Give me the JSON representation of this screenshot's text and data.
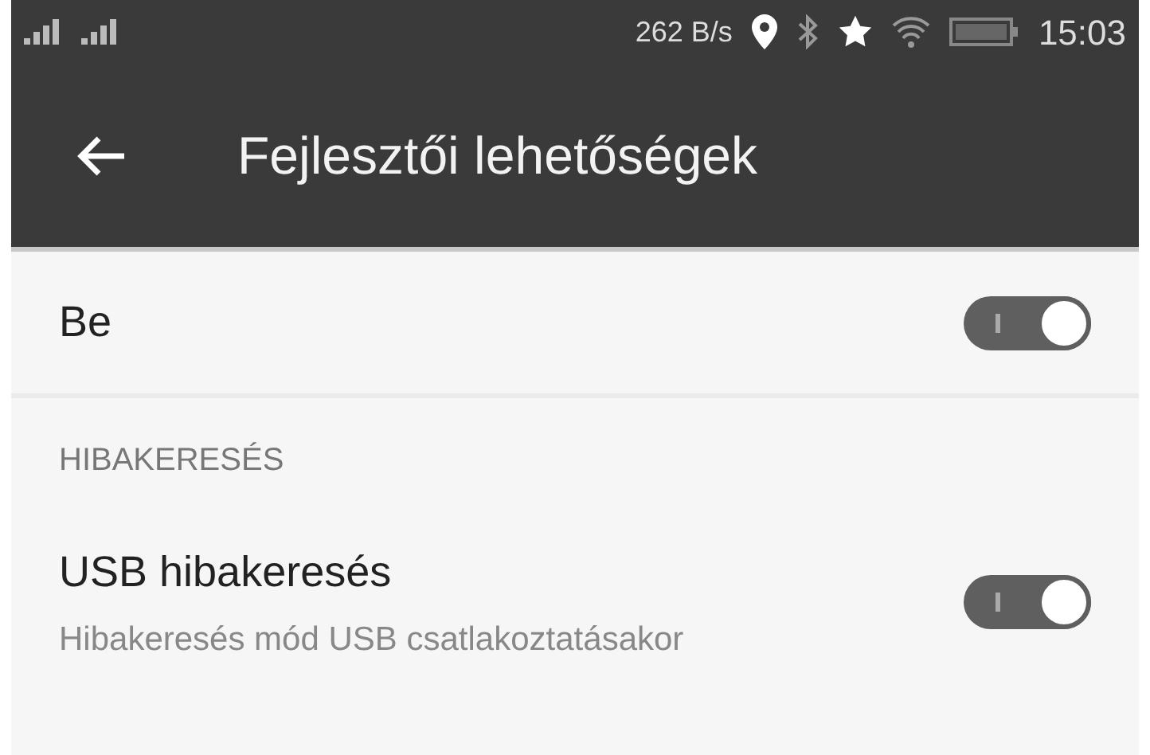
{
  "status_bar": {
    "speed": "262 B/s",
    "time": "15:03"
  },
  "app_bar": {
    "title": "Fejlesztői lehetőségek"
  },
  "master": {
    "label": "Be",
    "on": true
  },
  "sections": [
    {
      "header": "HIBAKERESÉS",
      "items": [
        {
          "title": "USB hibakeresés",
          "subtitle": "Hibakeresés mód USB csatlakoztatásakor",
          "on": true
        }
      ]
    }
  ]
}
